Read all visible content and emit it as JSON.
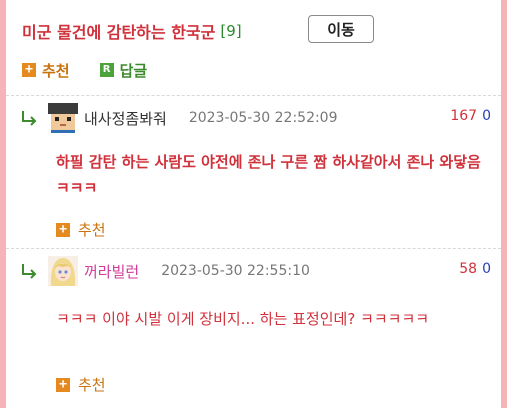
{
  "post": {
    "title": "미군 물건에 감탄하는 한국군",
    "comment_count": "[9]",
    "move_label": "이동"
  },
  "actions": {
    "recommend_label": "추천",
    "reply_label": "답글",
    "reply_icon_letter": "R"
  },
  "comments": [
    {
      "nickname": "내사정좀봐줘",
      "time": "2023-05-30 22:52:09",
      "up": "167",
      "down": "0",
      "text": "하필 감탄 하는 사람도 야전에 존나 구른 짬 하사같아서 존나 와닿음ㅋㅋㅋ",
      "recommend_label": "추천",
      "avatar_icon": "pixel-face-icon"
    },
    {
      "nickname": "꺼라빌런",
      "time": "2023-05-30 22:55:10",
      "up": "58",
      "down": "0",
      "text": "ㅋㅋㅋ 이야 시발 이게 장비지... 하는 표정인데? ㅋㅋㅋㅋㅋ",
      "recommend_label": "추천",
      "avatar_icon": "anime-girl-icon"
    }
  ],
  "colors": {
    "accent_red": "#d0323c",
    "recommend_orange": "#e58a1f",
    "reply_green": "#4ca23b",
    "background_pink": "#f6b3b8"
  }
}
